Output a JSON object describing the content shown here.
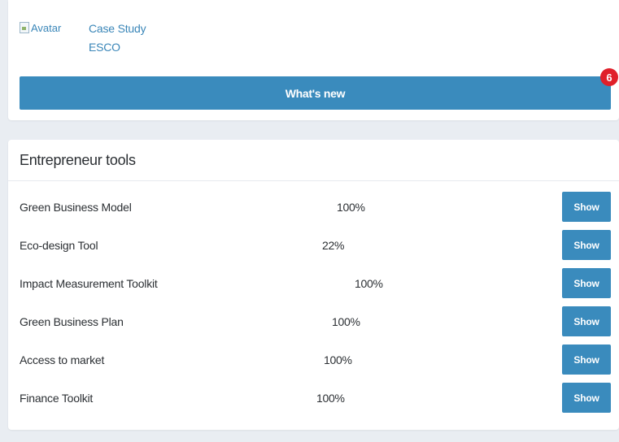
{
  "profile": {
    "avatar_alt": "Avatar",
    "case_study_link": "Case Study",
    "esco_link": "ESCO"
  },
  "whats_new": {
    "label": "What's new",
    "badge_count": "6"
  },
  "tools": {
    "title": "Entrepreneur tools",
    "items": [
      {
        "name": "Green Business Model",
        "progress": "100%",
        "action": "Show"
      },
      {
        "name": "Eco-design Tool",
        "progress": "22%",
        "action": "Show"
      },
      {
        "name": "Impact Measurement Toolkit",
        "progress": "100%",
        "action": "Show"
      },
      {
        "name": "Green Business Plan",
        "progress": "100%",
        "action": "Show"
      },
      {
        "name": "Access to market",
        "progress": "100%",
        "action": "Show"
      },
      {
        "name": "Finance Toolkit",
        "progress": "100%",
        "action": "Show"
      }
    ]
  },
  "colors": {
    "accent": "#3a8bbd",
    "badge": "#e0202a",
    "background": "#e9edf2"
  }
}
